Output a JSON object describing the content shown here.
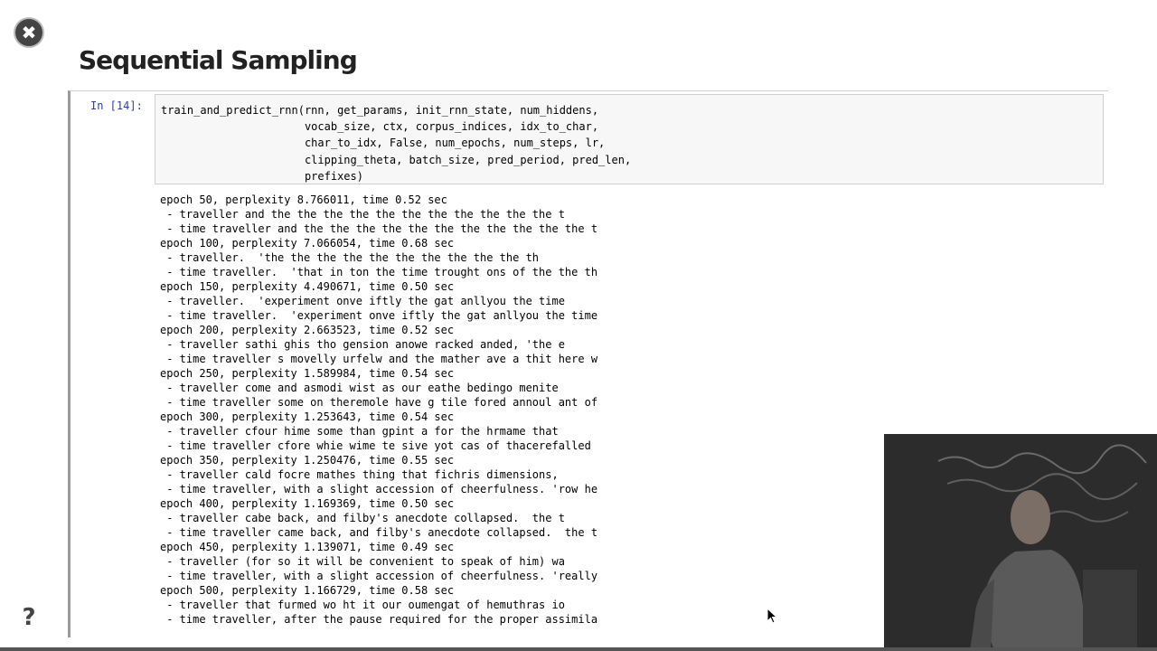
{
  "slide": {
    "title": "Sequential Sampling",
    "close_glyph": "✖",
    "help_glyph": "?"
  },
  "cell": {
    "prompt": "In [14]:",
    "code_lines": [
      "train_and_predict_rnn(rnn, get_params, init_rnn_state, num_hiddens,",
      "                      vocab_size, ctx, corpus_indices, idx_to_char,",
      "                      char_to_idx, False, num_epochs, num_steps, lr,",
      "                      clipping_theta, batch_size, pred_period, pred_len,",
      "                      prefixes)"
    ],
    "output_lines": [
      "epoch 50, perplexity 8.766011, time 0.52 sec",
      " - traveller and the the the the the the the the the the the t",
      " - time traveller and the the the the the the the the the the the t",
      "epoch 100, perplexity 7.066054, time 0.68 sec",
      " - traveller.  'the the the the the the the the the the th",
      " - time traveller.  'that in ton the time trought ons of the the th",
      "epoch 150, perplexity 4.490671, time 0.50 sec",
      " - traveller.  'experiment onve iftly the gat anllyou the time",
      " - time traveller.  'experiment onve iftly the gat anllyou the time",
      "epoch 200, perplexity 2.663523, time 0.52 sec",
      " - traveller sathi ghis tho gension anowe racked anded, 'the e",
      " - time traveller s movelly urfelw and the mather ave a thit here w",
      "epoch 250, perplexity 1.589984, time 0.54 sec",
      " - traveller come and asmodi wist as our eathe bedingo menite",
      " - time traveller some on theremole have g tile fored annoul ant of",
      "epoch 300, perplexity 1.253643, time 0.54 sec",
      " - traveller cfour hime some than gpint a for the hrmame that",
      " - time traveller cfore whie wime te sive yot cas of thacerefalled",
      "epoch 350, perplexity 1.250476, time 0.55 sec",
      " - traveller cald focre mathes thing that fichris dimensions,",
      " - time traveller, with a slight accession of cheerfulness. 'row he",
      "epoch 400, perplexity 1.169369, time 0.50 sec",
      " - traveller cabe back, and filby's anecdote collapsed.  the t",
      " - time traveller came back, and filby's anecdote collapsed.  the t",
      "epoch 450, perplexity 1.139071, time 0.49 sec",
      " - traveller (for so it will be convenient to speak of him) wa",
      " - time traveller, with a slight accession of cheerfulness. 'really",
      "epoch 500, perplexity 1.166729, time 0.58 sec",
      " - traveller that furmed wo ht it our oumengat of hemuthras io",
      " - time traveller, after the pause required for the proper assimila"
    ]
  },
  "colors": {
    "prompt": "#303f9f",
    "input_bg": "#f7f7f7",
    "webcam_bg": "#2c2c2c"
  }
}
